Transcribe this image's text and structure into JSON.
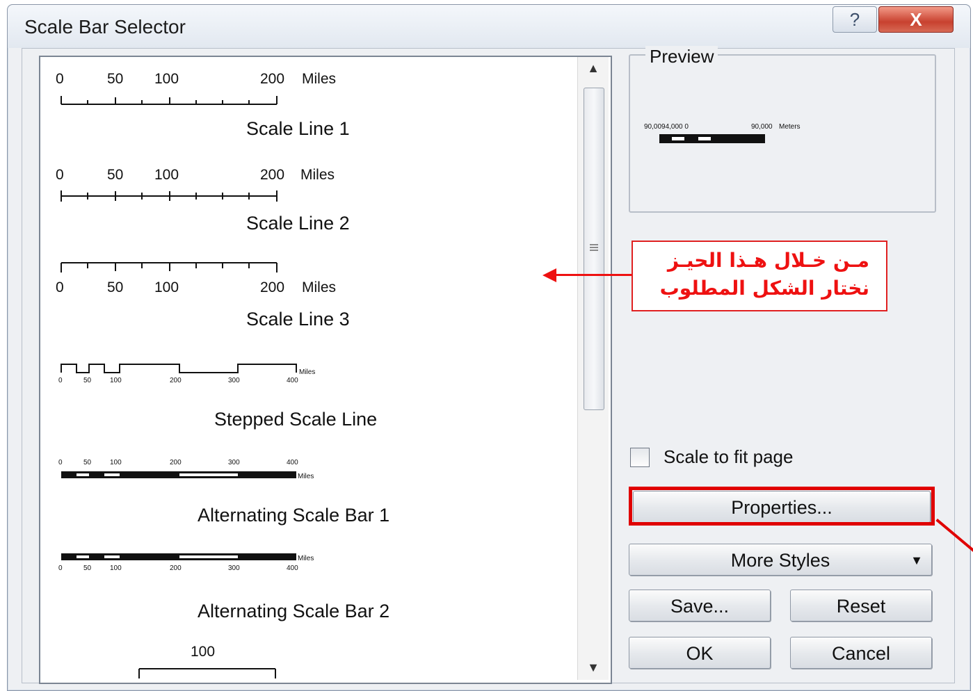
{
  "window": {
    "title": "Scale Bar Selector",
    "help_label": "?",
    "close_label": "X"
  },
  "list": {
    "items": [
      {
        "name": "Scale Line 1",
        "ticks": [
          "0",
          "50",
          "100",
          "200"
        ],
        "unit": "Miles"
      },
      {
        "name": "Scale Line 2",
        "ticks": [
          "0",
          "50",
          "100",
          "200"
        ],
        "unit": "Miles"
      },
      {
        "name": "Scale Line 3",
        "ticks": [
          "0",
          "50",
          "100",
          "200"
        ],
        "unit": "Miles"
      },
      {
        "name": "Stepped Scale Line",
        "ticks": [
          "0",
          "50",
          "100",
          "200",
          "300",
          "400"
        ],
        "unit": "Miles"
      },
      {
        "name": "Alternating Scale Bar 1",
        "ticks": [
          "0",
          "50",
          "100",
          "200",
          "300",
          "400"
        ],
        "unit": "Miles"
      },
      {
        "name": "Alternating Scale Bar 2",
        "ticks": [
          "0",
          "50",
          "100",
          "200",
          "300",
          "400"
        ],
        "unit": "Miles"
      },
      {
        "name": "",
        "ticks": [
          "100"
        ],
        "unit": ""
      }
    ]
  },
  "preview": {
    "label": "Preview",
    "left_ticks": "90,0094,000  0",
    "right_ticks": "90,000",
    "unit": "Meters"
  },
  "annotation": {
    "line1": "مـن خـلال هـذا الحيـز",
    "line2": "نختار الشكل المطلوب",
    "color": "#e11111"
  },
  "options": {
    "scale_to_fit_label": "Scale to fit page",
    "scale_to_fit_checked": false
  },
  "buttons": {
    "properties": "Properties...",
    "more_styles": "More Styles",
    "save": "Save...",
    "reset": "Reset",
    "ok": "OK",
    "cancel": "Cancel"
  }
}
